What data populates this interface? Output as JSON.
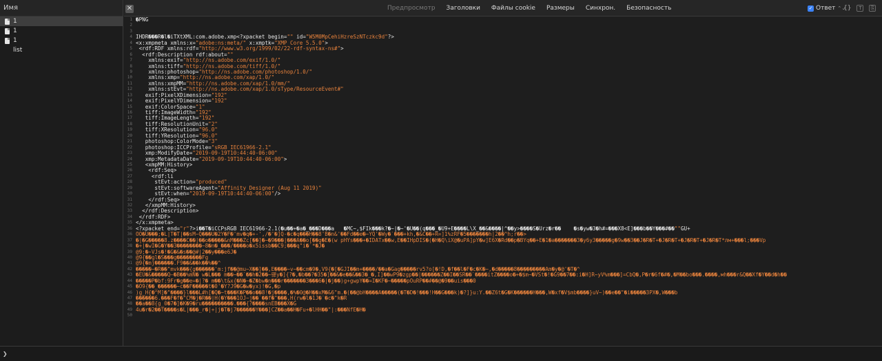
{
  "sidebar": {
    "header": "Имя",
    "items": [
      {
        "label": "1",
        "selected": true
      },
      {
        "label": "1",
        "selected": false
      },
      {
        "label": "1",
        "selected": false
      },
      {
        "label": "list",
        "selected": false
      }
    ]
  },
  "toolbar": {
    "close_label": "✕",
    "tabs": [
      {
        "label": "Предпросмотр",
        "disabled": true
      },
      {
        "label": "Заголовки",
        "disabled": false
      },
      {
        "label": "Файлы cookie",
        "disabled": false
      },
      {
        "label": "Размеры",
        "disabled": false
      },
      {
        "label": "Синхрон.",
        "disabled": false
      },
      {
        "label": "Безопасность",
        "disabled": false
      }
    ],
    "response_label": "Ответ",
    "response_icon": "check-icon",
    "braces_label": "{}",
    "accent_color": "#3b82f6"
  },
  "editor": {
    "lines": [
      {
        "n": "1",
        "text": "�PNG",
        "kind": "code"
      },
      {
        "n": "2",
        "text": "",
        "kind": "code"
      },
      {
        "n": "3",
        "text": "",
        "kind": "code"
      },
      {
        "n": "4",
        "text": "IHDR���R�l�iTXtXML:com.adobe.xmp<?xpacket begin=\"\" id=\"W5M0MpCehiHzreSzNTczkc9d\"?>",
        "kind": "code"
      },
      {
        "n": "4",
        "text": "<x:xmpmeta xmlns:x=\"adobe:ns:meta/\" x:xmptk=\"XMP Core 5.5.0\">",
        "kind": "code"
      },
      {
        "n": "5",
        "text": " <rdf:RDF xmlns:rdf=\"http://www.w3.org/1999/02/22-rdf-syntax-ns#\">",
        "kind": "code"
      },
      {
        "n": "6",
        "text": "  <rdf:Description rdf:about=\"\"",
        "kind": "code"
      },
      {
        "n": "7",
        "text": "    xmlns:exif=\"http://ns.adobe.com/exif/1.0/\"",
        "kind": "code"
      },
      {
        "n": "8",
        "text": "    xmlns:tiff=\"http://ns.adobe.com/tiff/1.0/\"",
        "kind": "code"
      },
      {
        "n": "9",
        "text": "    xmlns:photoshop=\"http://ns.adobe.com/photoshop/1.0/\"",
        "kind": "code"
      },
      {
        "n": "10",
        "text": "    xmlns:xmp=\"http://ns.adobe.com/xap/1.0/\"",
        "kind": "code"
      },
      {
        "n": "11",
        "text": "    xmlns:xmpMM=\"http://ns.adobe.com/xap/1.0/mm/\"",
        "kind": "code"
      },
      {
        "n": "12",
        "text": "    xmlns:stEvt=\"http://ns.adobe.com/xap/1.0/sType/ResourceEvent#\"",
        "kind": "code"
      },
      {
        "n": "13",
        "text": "   exif:PixelXDimension=\"192\"",
        "kind": "code"
      },
      {
        "n": "14",
        "text": "   exif:PixelYDimension=\"192\"",
        "kind": "code"
      },
      {
        "n": "15",
        "text": "   exif:ColorSpace=\"1\"",
        "kind": "code"
      },
      {
        "n": "16",
        "text": "   tiff:ImageWidth=\"192\"",
        "kind": "code"
      },
      {
        "n": "17",
        "text": "   tiff:ImageLength=\"192\"",
        "kind": "code"
      },
      {
        "n": "18",
        "text": "   tiff:ResolutionUnit=\"2\"",
        "kind": "code"
      },
      {
        "n": "19",
        "text": "   tiff:XResolution=\"96.0\"",
        "kind": "code"
      },
      {
        "n": "20",
        "text": "   tiff:YResolution=\"96.0\"",
        "kind": "code"
      },
      {
        "n": "21",
        "text": "   photoshop:ColorMode=\"3\"",
        "kind": "code"
      },
      {
        "n": "22",
        "text": "   photoshop:ICCProfile=\"sRGB IEC61966-2.1\"",
        "kind": "code"
      },
      {
        "n": "23",
        "text": "   xmp:ModifyDate=\"2019-09-19T10:44:40-06:00\"",
        "kind": "code"
      },
      {
        "n": "24",
        "text": "   xmp:MetadataDate=\"2019-09-19T10:44:40-06:00\">",
        "kind": "code"
      },
      {
        "n": "25",
        "text": "   <xmpMM:History>",
        "kind": "code"
      },
      {
        "n": "26",
        "text": "    <rdf:Seq>",
        "kind": "code"
      },
      {
        "n": "27",
        "text": "     <rdf:li",
        "kind": "code"
      },
      {
        "n": "28",
        "text": "      stEvt:action=\"produced\"",
        "kind": "code"
      },
      {
        "n": "29",
        "text": "      stEvt:softwareAgent=\"Affinity Designer (Aug 11 2019)\"",
        "kind": "code"
      },
      {
        "n": "30",
        "text": "      stEvt:when=\"2019-09-19T10:44:40-06:00\"/>",
        "kind": "code"
      },
      {
        "n": "31",
        "text": "    </rdf:Seq>",
        "kind": "code"
      },
      {
        "n": "32",
        "text": "   </xmpMM:History>",
        "kind": "code"
      },
      {
        "n": "33",
        "text": "  </rdf:Description>",
        "kind": "code"
      },
      {
        "n": "34",
        "text": " </rdf:RDF>",
        "kind": "code"
      },
      {
        "n": "35",
        "text": "</x:xmpmeta>",
        "kind": "code"
      },
      {
        "n": "36",
        "text": "<?xpacket end=\"r\"?>i��T�iCCPsRGB IEC61966-2.1(�u��+�a�_���D���a   �MC~,$FIk���k?�~|�~'�U��(q���_�U9+E����L\\X_��&����|^��y>����S�Urz�r��    �s�yw�3�h#=���X8<E]���b��Y���#��\"\"GU+",
        "kind": "code"
      },
      {
        "n": "36",
        "text": "OO�U���;�L|T�T|��sM~Q���U�2Y�F�'mv�q�+-',/�'�]Q-�c�q���H��8'B�n&'��Fd��e�~YQ'�Wy�`���+kh,�&C��+R=]1%zRF�5�������h|2��^h;r��>",
        "kind": "bin"
      },
      {
        "n": "37",
        "text": "�|�G�����8.z����C��|��o�����&nM���Zc[��]�~�9���|���A��o[��g�E�(w pHYs���+�IDATx��w,E��IHpDIS�(�H�Q\\iX@�uPA]pY�w]E6X�Rd��p�BYq��+E�1�a�������3�y6y3�����g�9w��3��J�R�T+�J�R�T+�J�R�T+�J�R�T*лм+���l;���Vp",
        "kind": "bin"
      },
      {
        "n": "38",
        "text": "�+|�wI�G�Y��3��������~8�n�_���/����o�x5issb��C9;���q\"i�`*�J�",
        "kind": "bin"
      },
      {
        "n": "39",
        "text": "@9;�~VJs�!�G�&�s��@#|2��y���e6J�",
        "kind": "bin"
      },
      {
        "n": "40",
        "text": "@9{��gl�S���g��������Fg",
        "kind": "bin"
      },
      {
        "n": "41",
        "text": "@9{�mj������.F9��&��k��%��^",
        "kind": "bin"
      },
      {
        "n": "42",
        "text": "�����~�R��\"mvk���{g������'m:jf��@mu~X��]��,E����~v~��cm�9�,V9{�[�GJI��m+����/��a�Gag�����rv5?o[�!D,�f��l�F�c�K�~,�d�����8���������Am�y�@'�T�^",
        "kind": "bin"
      },
      {
        "n": "43",
        "text": "�EU�&�����Q—�B��%mN� w�L��� m��~��`��h�2��~驿y�]{?�,�b��?�35�]��&�e��&��3�_�,I]��wP9�zgp��|������Z��I��SR��`����itZ����o�+�$m~�VSt�!�G9��7��:i�H]R~yV%m���]=CbQ�,P�r�6f�#�,�M��bo���.����,мh���r&Q��Xf�Y��d�h��",
        "kind": "bin"
      },
      {
        "n": "44",
        "text": "�����P�bf:9Fr�g��e=�|?� m��\\t&x{�N�~�Z�bw�n���r�������3���6�|�j��)g+gwpY��=I�KF�~�����pOuRP��#��@�9��uis���0",
        "kind": "bin"
      },
      {
        "n": "45",
        "text": "�O9{��_������~c��F�����t�0'�Y?J9�G�w�yx)!�G,�p",
        "kind": "bin"
      },
      {
        "n": "46",
        "text": ")g_H{�^M]�\"����}l���L#h[�Q�~t���K�P��o��8!�j����,�%�0@�H��xM�&6\"m.�(��@bH����A�����(�T�D�!���!H��G���k)�?]}u:Y.��Z6t�G�K������H���,W�xf�V$mb����}uV~)��e��\"�i�����3PX�,W���b",
        "kind": "bin"
      },
      {
        "n": "47",
        "text": "������6.���F�f�\"CM�j�R��|H(�Y���1OJ~j��`��f�\"���,H(rw�l�1J�`�c�\"k�R",
        "kind": "bin"
      },
      {
        "n": "48",
        "text": "��a��8{g_0�7�]�K�9�ru����������.���{?����snEB���X�G",
        "kind": "bin"
      },
      {
        "n": "49",
        "text": "4u�r�2��T����s�L|���_r�|+|j�T�j7������Y���]CZ��a��H�Fu+�lHH��\"|:���NfE�H�",
        "kind": "bin"
      },
      {
        "n": "50",
        "text": "",
        "kind": "bin"
      }
    ]
  },
  "console": {
    "prompt": "❯"
  }
}
